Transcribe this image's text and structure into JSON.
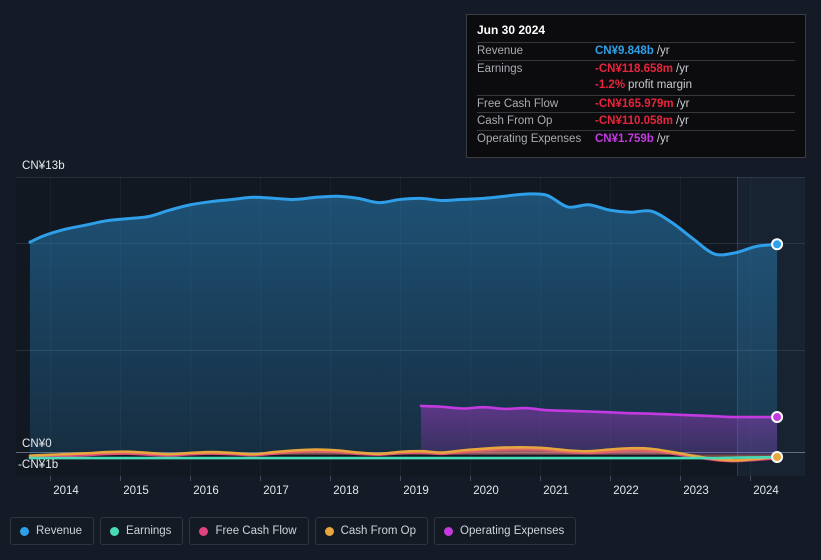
{
  "tooltip": {
    "date": "Jun 30 2024",
    "rows": [
      {
        "label": "Revenue",
        "value": "CN¥9.848b",
        "unit": "/yr",
        "color": "#2e9fe8"
      },
      {
        "label": "Earnings",
        "value": "-CN¥118.658m",
        "unit": "/yr",
        "color": "#e8243c"
      },
      {
        "label": "",
        "value": "-1.2%",
        "unit": "profit margin",
        "color": "#e8243c"
      },
      {
        "label": "Free Cash Flow",
        "value": "-CN¥165.979m",
        "unit": "/yr",
        "color": "#e8243c"
      },
      {
        "label": "Cash From Op",
        "value": "-CN¥110.058m",
        "unit": "/yr",
        "color": "#e8243c"
      },
      {
        "label": "Operating Expenses",
        "value": "CN¥1.759b",
        "unit": "/yr",
        "color": "#c33ae0"
      }
    ]
  },
  "legend": {
    "items": [
      {
        "label": "Revenue",
        "color": "#2e9fe8"
      },
      {
        "label": "Earnings",
        "color": "#49dbb7"
      },
      {
        "label": "Free Cash Flow",
        "color": "#e0437f"
      },
      {
        "label": "Cash From Op",
        "color": "#e8a73e"
      },
      {
        "label": "Operating Expenses",
        "color": "#c33ae0"
      }
    ]
  },
  "axes": {
    "y_labels": [
      "CN¥13b",
      "CN¥0",
      "-CN¥1b"
    ],
    "x_labels": [
      "2014",
      "2015",
      "2016",
      "2017",
      "2018",
      "2019",
      "2020",
      "2021",
      "2022",
      "2023",
      "2024"
    ]
  },
  "chart_data": {
    "type": "area",
    "title": "",
    "xlabel": "",
    "ylabel": "",
    "ylim": [
      -1,
      13
    ],
    "xlim": [
      2013.6,
      2024.9
    ],
    "grid": true,
    "legend_position": "bottom",
    "currency": "CN¥",
    "units": "billions",
    "annotation": {
      "hover_date": "Jun 30 2024",
      "revenue": 9.848,
      "earnings": -0.118658,
      "profit_margin_pct": -1.2,
      "free_cash_flow": -0.165979,
      "cash_from_op": -0.110058,
      "operating_expenses": 1.759
    },
    "forecast_region_start": "2023.9",
    "x": [
      2013.8,
      2014.0,
      2014.3,
      2014.6,
      2014.9,
      2015.2,
      2015.5,
      2015.8,
      2016.1,
      2016.4,
      2016.7,
      2017.0,
      2017.3,
      2017.6,
      2017.9,
      2018.2,
      2018.5,
      2018.8,
      2019.1,
      2019.4,
      2019.7,
      2020.0,
      2020.3,
      2020.6,
      2020.9,
      2021.2,
      2021.5,
      2021.8,
      2022.1,
      2022.4,
      2022.7,
      2023.0,
      2023.3,
      2023.6,
      2023.9,
      2024.2,
      2024.5
    ],
    "series": [
      {
        "name": "Revenue",
        "color": "#2e9fe8",
        "values": [
          9.95,
          10.25,
          10.55,
          10.75,
          10.95,
          11.05,
          11.15,
          11.45,
          11.7,
          11.85,
          11.95,
          12.05,
          12.0,
          11.95,
          12.05,
          12.1,
          12.0,
          11.8,
          11.95,
          12.0,
          11.9,
          11.95,
          12.0,
          12.1,
          12.2,
          12.15,
          11.6,
          11.7,
          11.45,
          11.35,
          11.4,
          10.85,
          10.1,
          9.4,
          9.45,
          9.75,
          9.85
        ]
      },
      {
        "name": "Earnings",
        "color": "#49dbb7",
        "values": [
          -0.16,
          -0.16,
          -0.16,
          -0.16,
          -0.16,
          -0.16,
          -0.16,
          -0.16,
          -0.16,
          -0.16,
          -0.16,
          -0.16,
          -0.16,
          -0.16,
          -0.16,
          -0.16,
          -0.16,
          -0.16,
          -0.16,
          -0.16,
          -0.16,
          -0.16,
          -0.16,
          -0.16,
          -0.16,
          -0.16,
          -0.16,
          -0.16,
          -0.16,
          -0.16,
          -0.16,
          -0.16,
          -0.16,
          -0.16,
          -0.14,
          -0.13,
          -0.12
        ]
      },
      {
        "name": "Free Cash Flow",
        "color": "#e0437f",
        "values": [
          -0.1,
          -0.08,
          -0.05,
          -0.02,
          0.03,
          0.05,
          0.0,
          -0.04,
          0.02,
          0.05,
          0.02,
          -0.02,
          0.05,
          0.12,
          0.16,
          0.12,
          0.04,
          0.0,
          0.07,
          0.1,
          0.04,
          0.12,
          0.2,
          0.25,
          0.26,
          0.22,
          0.12,
          0.08,
          0.14,
          0.2,
          0.18,
          0.05,
          -0.1,
          -0.24,
          -0.3,
          -0.24,
          -0.17
        ]
      },
      {
        "name": "Cash From Op",
        "color": "#e8a73e",
        "values": [
          -0.05,
          -0.02,
          0.02,
          0.06,
          0.12,
          0.14,
          0.08,
          0.02,
          0.08,
          0.12,
          0.08,
          0.02,
          0.12,
          0.2,
          0.24,
          0.2,
          0.1,
          0.04,
          0.13,
          0.16,
          0.1,
          0.2,
          0.28,
          0.33,
          0.34,
          0.3,
          0.2,
          0.16,
          0.24,
          0.3,
          0.27,
          0.12,
          -0.05,
          -0.2,
          -0.27,
          -0.2,
          -0.11
        ]
      },
      {
        "name": "Operating Expenses",
        "color": "#c33ae0",
        "values": [
          null,
          null,
          null,
          null,
          null,
          null,
          null,
          null,
          null,
          null,
          null,
          null,
          null,
          null,
          null,
          null,
          null,
          null,
          null,
          2.28,
          2.24,
          2.16,
          2.22,
          2.14,
          2.18,
          2.08,
          2.05,
          2.02,
          1.98,
          1.94,
          1.92,
          1.88,
          1.84,
          1.8,
          1.76,
          1.76,
          1.76
        ]
      }
    ]
  }
}
